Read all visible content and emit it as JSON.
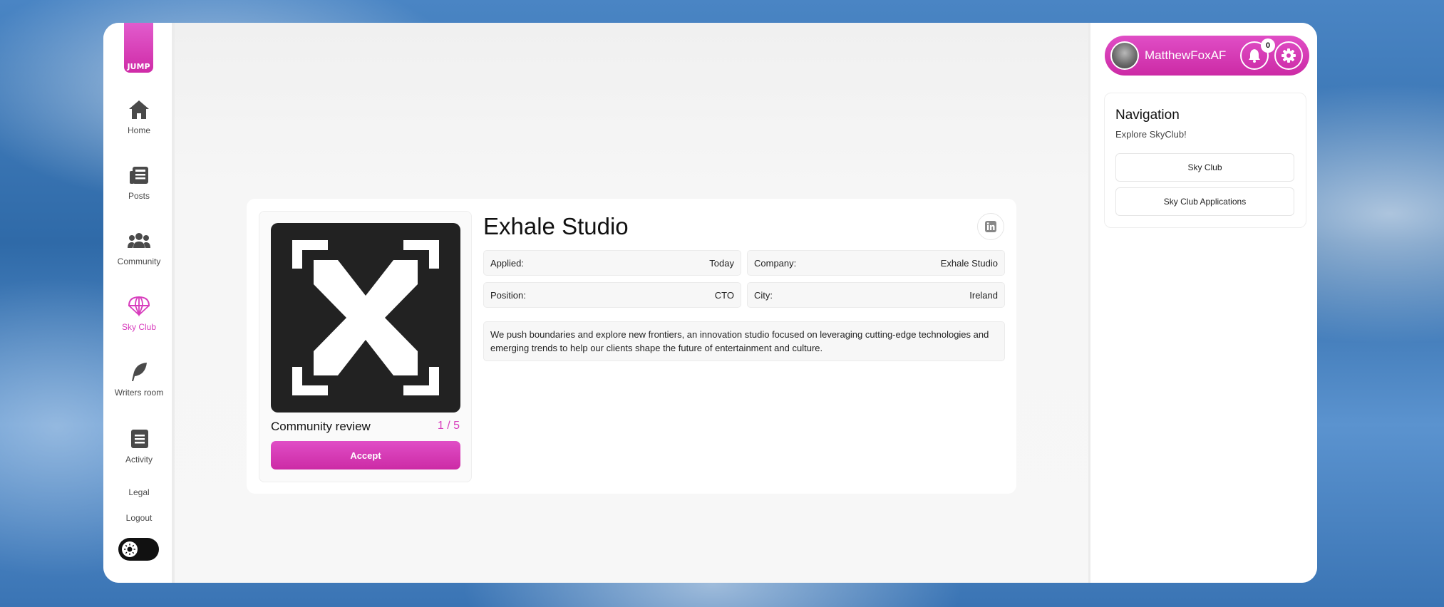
{
  "app": {
    "logo_text": "JUMP",
    "brand_color": "#d83dbd"
  },
  "sidebar": {
    "items": [
      {
        "label": "Home",
        "icon": "home-icon"
      },
      {
        "label": "Posts",
        "icon": "newspaper-icon"
      },
      {
        "label": "Community",
        "icon": "users-icon"
      },
      {
        "label": "Sky Club",
        "icon": "parachute-icon",
        "active": true
      },
      {
        "label": "Writers room",
        "icon": "feather-icon"
      },
      {
        "label": "Activity",
        "icon": "list-icon"
      }
    ],
    "legal": "Legal",
    "logout": "Logout",
    "theme_toggle": "sun-icon"
  },
  "company": {
    "name": "Exhale Studio",
    "fields": {
      "applied_label": "Applied:",
      "applied_value": "Today",
      "company_label": "Company:",
      "company_value": "Exhale Studio",
      "position_label": "Position:",
      "position_value": "CTO",
      "city_label": "City:",
      "city_value": "Ireland"
    },
    "description": "We push boundaries and explore new frontiers, an innovation studio focused on leveraging cutting-edge technologies and emerging trends to help our clients shape the future of entertainment and culture.",
    "review_label": "Community review",
    "review_count": "1 / 5",
    "accept_label": "Accept",
    "social_icon": "linkedin-icon"
  },
  "user": {
    "name": "MatthewFoxAF",
    "notifications": "0"
  },
  "navigation": {
    "title": "Navigation",
    "subtitle": "Explore SkyClub!",
    "links": [
      "Sky Club",
      "Sky Club Applications"
    ]
  }
}
